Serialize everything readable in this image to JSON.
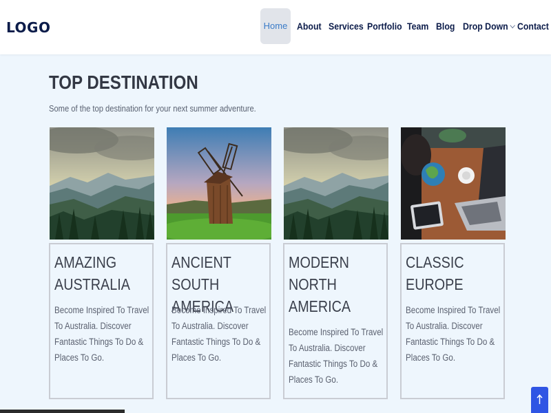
{
  "header": {
    "logo": "LOGO",
    "nav": [
      "Home",
      "About",
      "Services",
      "Portfolio",
      "Team",
      "Blog",
      "Drop Down",
      "Contact"
    ]
  },
  "section": {
    "title": "TOP DESTINATION",
    "subtitle": "Some of the top destination for your next summer adventure."
  },
  "cards": [
    {
      "title": "AMAZING AUSTRALIA",
      "text": "Become Inspired To Travel To Australia. Discover Fantastic Things To Do & Places To Go.",
      "image": "mountain-valley-image"
    },
    {
      "title": "ANCIENT SOUTH AMERICA",
      "text": "Become Inspired To Travel To Australia. Discover Fantastic Things To Do & Places To Go.",
      "image": "windmill-image"
    },
    {
      "title": "MODERN NORTH AMERICA",
      "text": "Become Inspired To Travel To Australia. Discover Fantastic Things To Do & Places To Go.",
      "image": "mountain-valley-image"
    },
    {
      "title": "CLASSIC EUROPE",
      "text": "Become Inspired To Travel To Australia. Discover Fantastic Things To Do & Places To Go.",
      "image": "globe-laptop-image"
    }
  ],
  "icons": {
    "scroll_top": "arrow-up-icon",
    "dropdown": "chevron-down-icon"
  },
  "colors": {
    "brand": "#0c1c4a",
    "accent": "#3a7bc8",
    "scroll_button": "#2f55e4",
    "background": "#eef6fd"
  }
}
